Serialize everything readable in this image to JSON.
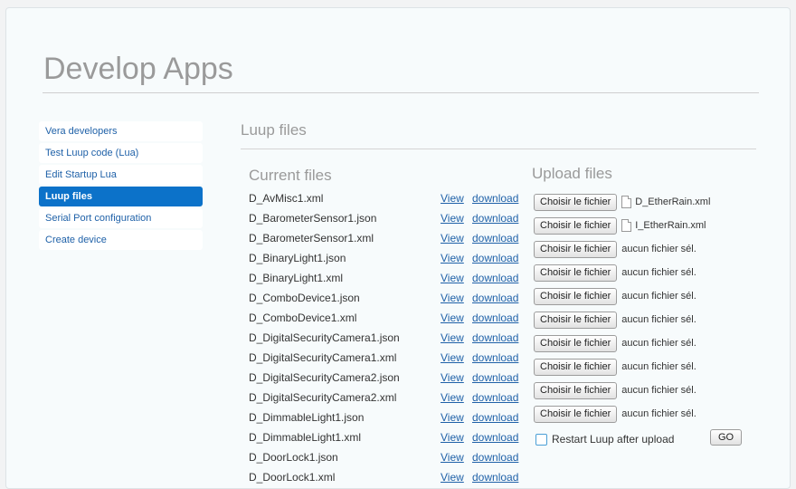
{
  "page": {
    "title": "Develop Apps",
    "section_title": "Luup files"
  },
  "sidebar": {
    "items": [
      {
        "label": "Vera developers",
        "active": false
      },
      {
        "label": "Test Luup code (Lua)",
        "active": false
      },
      {
        "label": "Edit Startup Lua",
        "active": false
      },
      {
        "label": "Luup files",
        "active": true
      },
      {
        "label": "Serial Port configuration",
        "active": false
      },
      {
        "label": "Create device",
        "active": false
      }
    ]
  },
  "current_files": {
    "heading": "Current files",
    "view_label": "View",
    "download_label": "download",
    "files": [
      "D_AvMisc1.xml",
      "D_BarometerSensor1.json",
      "D_BarometerSensor1.xml",
      "D_BinaryLight1.json",
      "D_BinaryLight1.xml",
      "D_ComboDevice1.json",
      "D_ComboDevice1.xml",
      "D_DigitalSecurityCamera1.json",
      "D_DigitalSecurityCamera1.xml",
      "D_DigitalSecurityCamera2.json",
      "D_DigitalSecurityCamera2.xml",
      "D_DimmableLight1.json",
      "D_DimmableLight1.xml",
      "D_DoorLock1.json",
      "D_DoorLock1.xml"
    ]
  },
  "upload_files": {
    "heading": "Upload files",
    "button_label": "Choisir le fichier",
    "slots": [
      {
        "status": "D_EtherRain.xml",
        "has_file": true
      },
      {
        "status": "I_EtherRain.xml",
        "has_file": true
      },
      {
        "status": "aucun fichier sél.",
        "has_file": false
      },
      {
        "status": "aucun fichier sél.",
        "has_file": false
      },
      {
        "status": "aucun fichier sél.",
        "has_file": false
      },
      {
        "status": "aucun fichier sél.",
        "has_file": false
      },
      {
        "status": "aucun fichier sél.",
        "has_file": false
      },
      {
        "status": "aucun fichier sél.",
        "has_file": false
      },
      {
        "status": "aucun fichier sél.",
        "has_file": false
      },
      {
        "status": "aucun fichier sél.",
        "has_file": false
      }
    ],
    "restart_label": "Restart Luup after upload",
    "restart_checked": false,
    "go_label": "GO"
  },
  "colors": {
    "accent": "#0c72c9",
    "link": "#1f61a8"
  }
}
